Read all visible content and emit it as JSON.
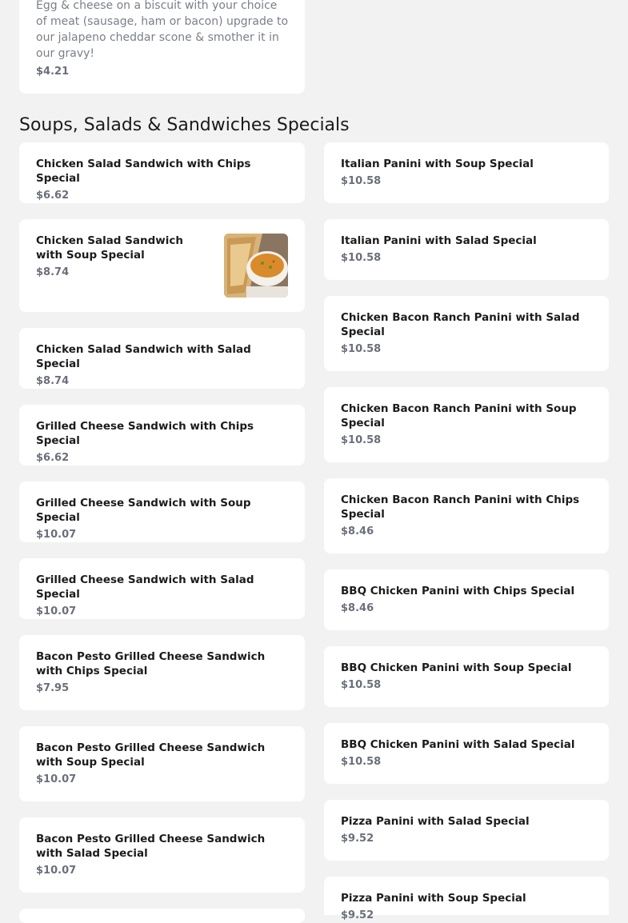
{
  "top_item": {
    "description": "Egg & cheese on a biscuit with your choice of meat (sausage, ham or bacon) upgrade to our jalapeno cheddar scone & smother it in our gravy!",
    "price": "$4.21"
  },
  "section": {
    "heading": "Soups, Salads & Sandwiches Specials"
  },
  "left_items": [
    {
      "name": "Chicken Salad Sandwich with Chips Special",
      "price": "$6.62"
    },
    {
      "name": "Chicken Salad Sandwich with Soup Special",
      "price": "$8.74"
    },
    {
      "name": "Chicken Salad Sandwich with Salad Special",
      "price": "$8.74"
    },
    {
      "name": "Grilled Cheese Sandwich with Chips Special",
      "price": "$6.62"
    },
    {
      "name": "Grilled Cheese Sandwich with Soup Special",
      "price": "$10.07"
    },
    {
      "name": "Grilled Cheese Sandwich with Salad Special",
      "price": "$10.07"
    },
    {
      "name": "Bacon Pesto Grilled Cheese Sandwich with Chips Special",
      "price": "$7.95"
    },
    {
      "name": "Bacon Pesto Grilled Cheese Sandwich with Soup Special",
      "price": "$10.07"
    },
    {
      "name": "Bacon Pesto Grilled Cheese Sandwich with Salad Special",
      "price": "$10.07"
    }
  ],
  "right_items": [
    {
      "name": "Italian Panini with Soup Special",
      "price": "$10.58"
    },
    {
      "name": "Italian Panini with Salad Special",
      "price": "$10.58"
    },
    {
      "name": "Chicken Bacon Ranch Panini with Salad Special",
      "price": "$10.58"
    },
    {
      "name": "Chicken Bacon Ranch Panini with Soup Special",
      "price": "$10.58"
    },
    {
      "name": "Chicken Bacon Ranch Panini with Chips Special",
      "price": "$8.46"
    },
    {
      "name": "BBQ Chicken Panini with Chips Special",
      "price": "$8.46"
    },
    {
      "name": "BBQ Chicken Panini with Soup Special",
      "price": "$10.58"
    },
    {
      "name": "BBQ Chicken Panini with Salad Special",
      "price": "$10.58"
    },
    {
      "name": "Pizza Panini with Salad Special",
      "price": "$9.52"
    },
    {
      "name": "Pizza Panini with Soup Special",
      "price": "$9.52"
    }
  ]
}
